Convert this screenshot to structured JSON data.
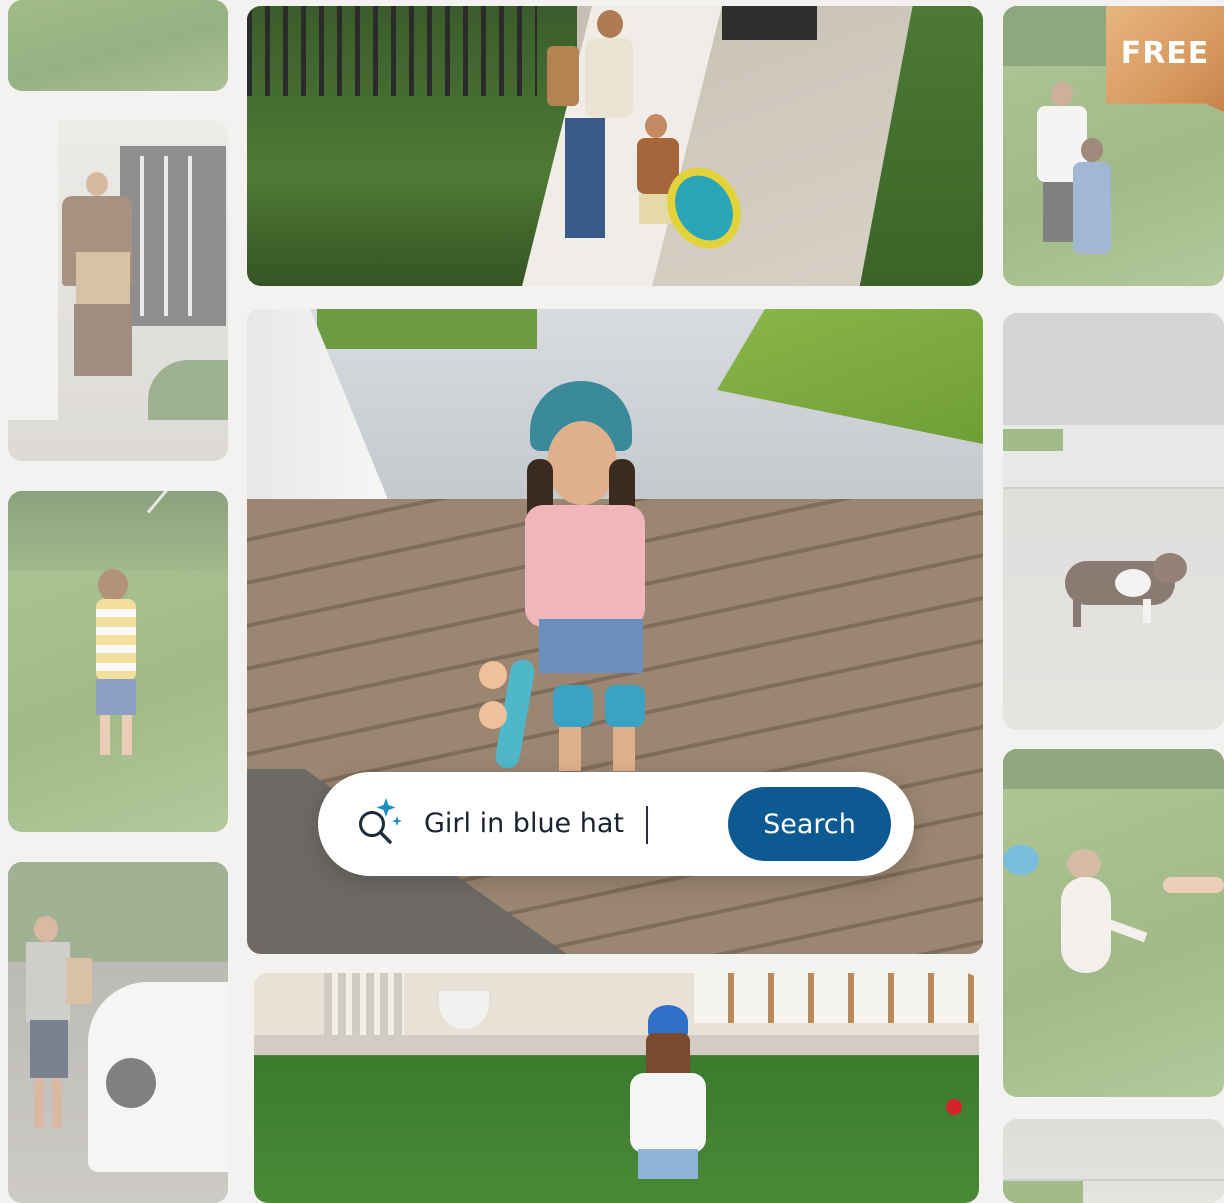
{
  "search": {
    "query": "Girl in blue hat",
    "button_label": "Search",
    "icon": "sparkle-search-icon"
  },
  "badge": {
    "label": "FREE"
  },
  "colors": {
    "background": "#f4f2f0",
    "search_button": "#0d5a92",
    "badge": "#d89a60"
  },
  "tiles": [
    {
      "name": "tile-lawn-top-left",
      "scene": "lawn"
    },
    {
      "name": "tile-delivery-man",
      "scene": "delivery person holding package at gate"
    },
    {
      "name": "tile-boy-hose",
      "scene": "boy spraying garden hose on lawn"
    },
    {
      "name": "tile-man-groceries",
      "scene": "man with groceries next to white car"
    },
    {
      "name": "tile-mother-daughter-walkway",
      "scene": "mother and daughter walking on patio"
    },
    {
      "name": "tile-girl-skateboard",
      "scene": "girl in blue helmet holding skateboard on porch"
    },
    {
      "name": "tile-girl-blue-hat-lawn",
      "scene": "girl in blue hat running on lawn"
    },
    {
      "name": "tile-father-daughter",
      "scene": "father and daughter on lawn"
    },
    {
      "name": "tile-dog-driveway",
      "scene": "dog running on driveway"
    },
    {
      "name": "tile-dog-frisbee",
      "scene": "dog jumping for frisbee"
    },
    {
      "name": "tile-bottom-right",
      "scene": "driveway"
    }
  ]
}
